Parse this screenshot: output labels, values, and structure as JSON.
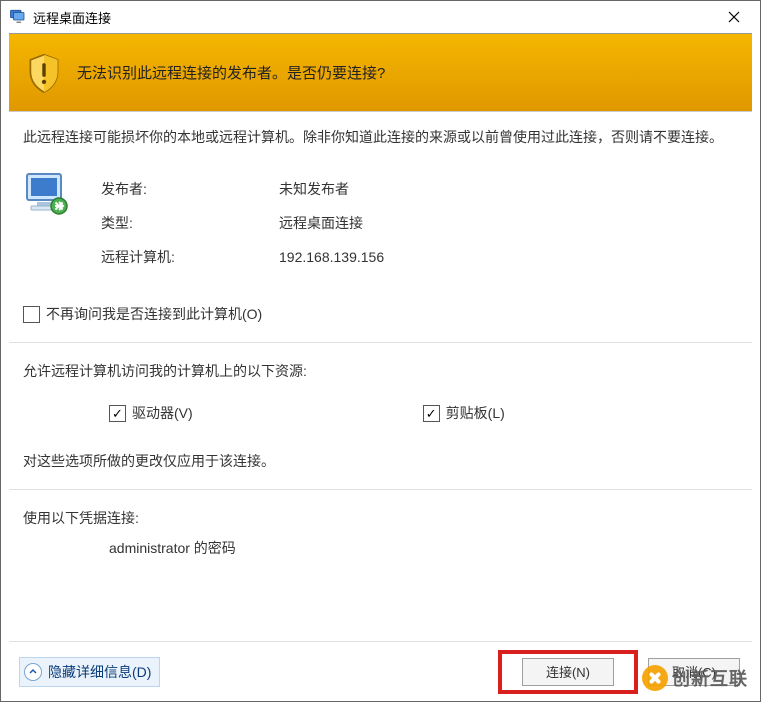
{
  "title": "远程桌面连接",
  "warning": "无法识别此远程连接的发布者。是否仍要连接?",
  "description": "此远程连接可能损坏你的本地或远程计算机。除非你知道此连接的来源或以前曾使用过此连接，否则请不要连接。",
  "info": {
    "publisher_label": "发布者:",
    "publisher_value": "未知发布者",
    "type_label": "类型:",
    "type_value": "远程桌面连接",
    "remote_computer_label": "远程计算机:",
    "remote_computer_value": "192.168.139.156"
  },
  "dont_ask_label": "不再询问我是否连接到此计算机(O)",
  "resources": {
    "title": "允许远程计算机访问我的计算机上的以下资源:",
    "drives_label": "驱动器(V)",
    "clipboard_label": "剪贴板(L)",
    "note": "对这些选项所做的更改仅应用于该连接。"
  },
  "credentials": {
    "title": "使用以下凭据连接:",
    "line": "administrator 的密码"
  },
  "bottom": {
    "hide_details": "隐藏详细信息(D)",
    "connect": "连接(N)",
    "cancel": "取消(C)"
  },
  "watermark": "创新互联"
}
